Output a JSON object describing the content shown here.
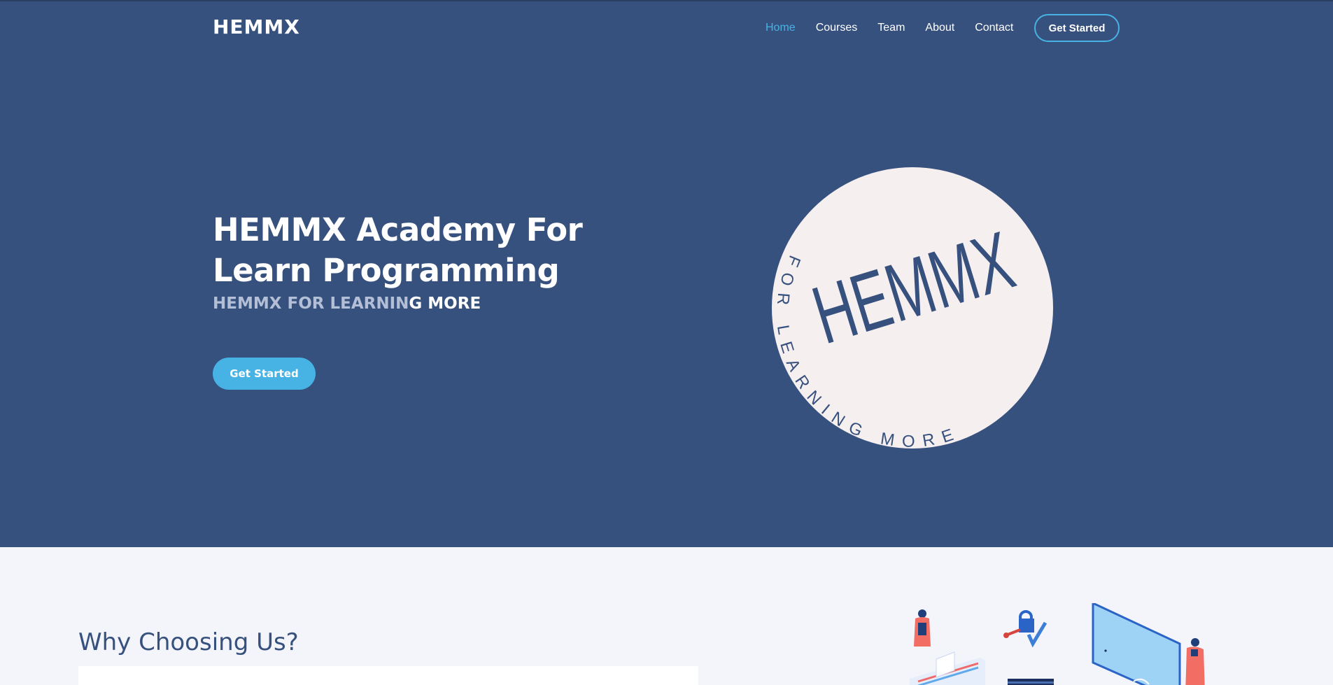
{
  "header": {
    "logo": "HEMMX",
    "nav": [
      {
        "label": "Home",
        "active": true
      },
      {
        "label": "Courses",
        "active": false
      },
      {
        "label": "Team",
        "active": false
      },
      {
        "label": "About",
        "active": false
      },
      {
        "label": "Contact",
        "active": false
      }
    ],
    "cta_label": "Get Started"
  },
  "hero": {
    "title": "HEMMX Academy For Learn Programming",
    "subtitle_dim": "HEMMX FOR LEARNIN",
    "subtitle_bright": "G MORE",
    "button_label": "Get Started",
    "emblem": {
      "main_text": "HEMMX",
      "ring_text": "FOR LEARNING MORE"
    }
  },
  "why": {
    "title": "Why Choosing Us?"
  },
  "colors": {
    "primary": "#37517e",
    "accent": "#47b2e4",
    "emblem_bg": "#f6eff0",
    "section_bg": "#f3f5fa"
  }
}
